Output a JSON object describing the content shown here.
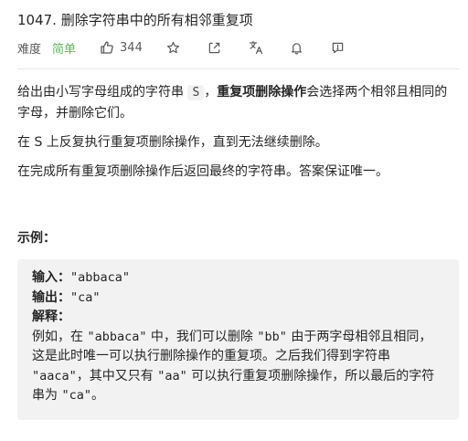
{
  "problem": {
    "title": "1047. 删除字符串中的所有相邻重复项",
    "difficulty_label": "难度",
    "difficulty_value": "简单",
    "likes": "344"
  },
  "description": {
    "p1_a": "给出由小写字母组成的字符串 ",
    "p1_code": "S",
    "p1_b": "，",
    "p1_strong": "重复项删除操作",
    "p1_c": "会选择两个相邻且相同的字母，并删除它们。",
    "p2": "在 S 上反复执行重复项删除操作，直到无法继续删除。",
    "p3": "在完成所有重复项删除操作后返回最终的字符串。答案保证唯一。"
  },
  "example": {
    "title": "示例：",
    "input_label": "输入：",
    "input_value": "\"abbaca\"",
    "output_label": "输出：",
    "output_value": "\"ca\"",
    "explain_label": "解释：",
    "explain_1": "例如，在 ",
    "explain_1_code": "\"abbaca\"",
    "explain_2": " 中，我们可以删除 ",
    "explain_2_code": "\"bb\"",
    "explain_3": " 由于两字母相邻且相同，这是此时唯一可以执行删除操作的重复项。之后我们得到字符串 ",
    "explain_3_code": "\"aaca\"",
    "explain_4": "，其中又只有 ",
    "explain_4_code": "\"aa\"",
    "explain_5": " 可以执行重复项删除操作，所以最后的字符串为 ",
    "explain_5_code": "\"ca\"",
    "explain_6": "。"
  },
  "colors": {
    "easy": "#5cb85c",
    "text": "#262626",
    "meta": "#595959",
    "example_bg": "#f2f2f2"
  },
  "icons": [
    "like-icon",
    "star-icon",
    "share-icon",
    "translate-icon",
    "bell-icon",
    "feedback-icon"
  ]
}
